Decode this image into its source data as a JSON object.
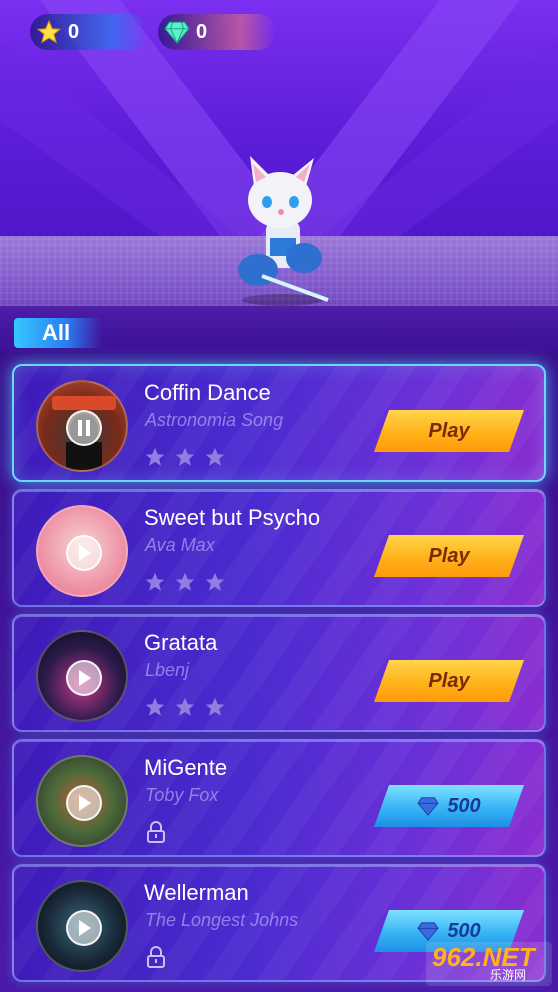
{
  "hud": {
    "stars": "0",
    "gems": "0",
    "star_icon": "star-icon",
    "gem_icon": "diamond-icon"
  },
  "tabs": [
    {
      "label": "All",
      "active": true
    }
  ],
  "songs": [
    {
      "title": "Coffin Dance",
      "artist": "Astronomia Song",
      "status": "playing",
      "stars_earned": 0,
      "stars_total": 3,
      "action": {
        "type": "play",
        "label": "Play"
      }
    },
    {
      "title": "Sweet but Psycho",
      "artist": "Ava Max",
      "status": "paused",
      "stars_earned": 0,
      "stars_total": 3,
      "action": {
        "type": "play",
        "label": "Play"
      }
    },
    {
      "title": "Gratata",
      "artist": "Lbenj",
      "status": "paused",
      "stars_earned": 0,
      "stars_total": 3,
      "action": {
        "type": "play",
        "label": "Play"
      }
    },
    {
      "title": "MiGente",
      "artist": "Toby Fox",
      "status": "locked",
      "action": {
        "type": "unlock",
        "label": "500",
        "currency": "gems"
      }
    },
    {
      "title": "Wellerman",
      "artist": "The Longest Johns",
      "status": "locked",
      "action": {
        "type": "unlock",
        "label": "500",
        "currency": "gems"
      }
    }
  ],
  "watermark": {
    "main": "962.NET",
    "sub": "乐游网"
  },
  "colors": {
    "play_button": "#ffb21a",
    "gem_button": "#37b4f5",
    "accent": "#6ad8ff",
    "background": "#3a0f8a"
  }
}
